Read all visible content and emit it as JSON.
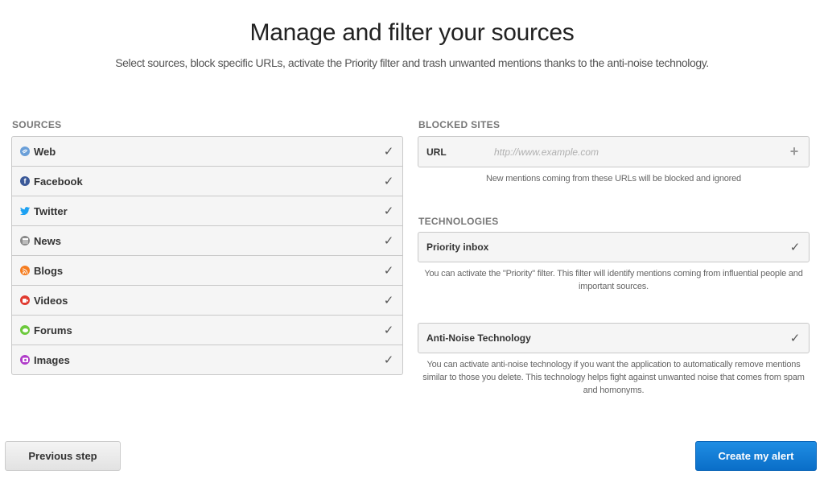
{
  "header": {
    "title": "Manage and filter your sources",
    "subtitle": "Select sources, block specific URLs, activate the Priority filter and trash unwanted mentions thanks to the anti-noise technology."
  },
  "sources": {
    "label": "SOURCES",
    "items": [
      {
        "label": "Web",
        "icon": "globe-icon",
        "color": "#6a9fd8",
        "checked": true,
        "check_glyph": "✓"
      },
      {
        "label": "Facebook",
        "icon": "facebook-icon",
        "color": "#3b5998",
        "checked": true,
        "check_glyph": "✓"
      },
      {
        "label": "Twitter",
        "icon": "twitter-icon",
        "color": "#1da1f2",
        "checked": true,
        "check_glyph": "✓"
      },
      {
        "label": "News",
        "icon": "newspaper-icon",
        "color": "#8a8a8a",
        "checked": true,
        "check_glyph": "✓"
      },
      {
        "label": "Blogs",
        "icon": "rss-icon",
        "color": "#f57c1f",
        "checked": true,
        "check_glyph": "✓"
      },
      {
        "label": "Videos",
        "icon": "video-icon",
        "color": "#e03a2f",
        "checked": true,
        "check_glyph": "✓"
      },
      {
        "label": "Forums",
        "icon": "chat-bubble-icon",
        "color": "#6cc93c",
        "checked": true,
        "check_glyph": "✓"
      },
      {
        "label": "Images",
        "icon": "camera-icon",
        "color": "#b03cc9",
        "checked": true,
        "check_glyph": "✓"
      }
    ]
  },
  "blocked_sites": {
    "label": "BLOCKED SITES",
    "url_label": "URL",
    "url_value": "",
    "url_placeholder": "http://www.example.com",
    "add_glyph": "+",
    "note": "New mentions coming from these URLs will be blocked and ignored"
  },
  "technologies": {
    "label": "TECHNOLOGIES",
    "items": [
      {
        "label": "Priority inbox",
        "checked": true,
        "check_glyph": "✓",
        "description": "You can activate the \"Priority\" filter. This filter will identify mentions coming from influential people and important sources."
      },
      {
        "label": "Anti-Noise Technology",
        "checked": true,
        "check_glyph": "✓",
        "description": "You can activate anti-noise technology if you want the application to automatically remove mentions similar to those you delete. This technology helps fight against unwanted noise that comes from spam and homonyms."
      }
    ]
  },
  "footer": {
    "previous_label": "Previous step",
    "create_label": "Create my alert",
    "accent_color": "#1479d4"
  }
}
